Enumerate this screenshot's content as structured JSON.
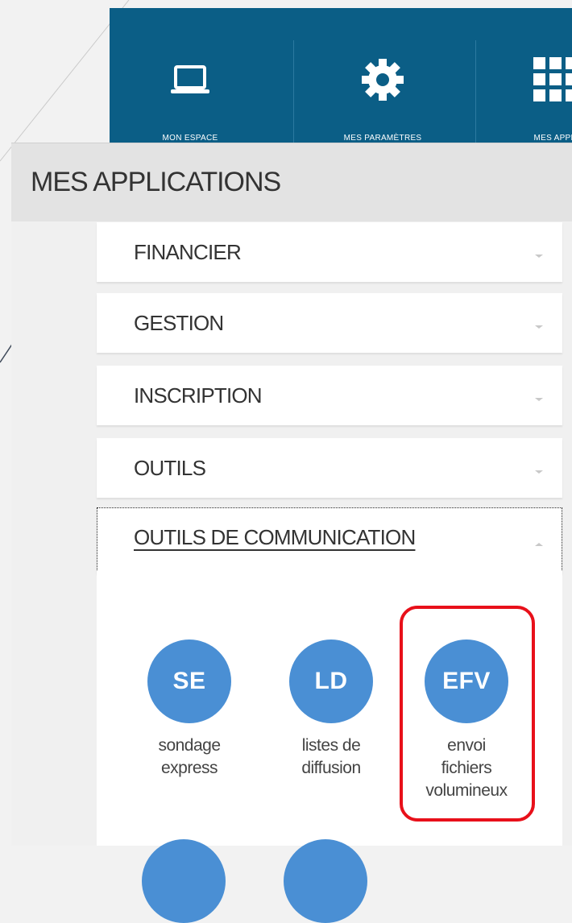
{
  "nav": {
    "items": [
      {
        "label": "MON ESPACE",
        "icon": "laptop-icon"
      },
      {
        "label": "MES PARAMÈTRES",
        "icon": "gear-icon"
      },
      {
        "label": "MES APPLI",
        "icon": "grid-icon"
      }
    ],
    "background": "#0b5e86"
  },
  "section": {
    "title": "MES APPLICATIONS"
  },
  "categories": [
    {
      "label": "FINANCIER",
      "state": "collapsed"
    },
    {
      "label": "GESTION",
      "state": "collapsed"
    },
    {
      "label": "INSCRIPTION",
      "state": "collapsed"
    },
    {
      "label": "OUTILS",
      "state": "collapsed"
    },
    {
      "label": "OUTILS DE COMMUNICATION",
      "state": "expanded"
    }
  ],
  "apps": [
    {
      "abbr": "SE",
      "name_line1": "sondage",
      "name_line2": "express",
      "name_line3": ""
    },
    {
      "abbr": "LD",
      "name_line1": "listes de",
      "name_line2": "diffusion",
      "name_line3": ""
    },
    {
      "abbr": "EFV",
      "name_line1": "envoi",
      "name_line2": "fichiers",
      "name_line3": "volumineux"
    }
  ],
  "colors": {
    "app_circle": "#4a8fd4",
    "highlight": "#e8101a"
  }
}
